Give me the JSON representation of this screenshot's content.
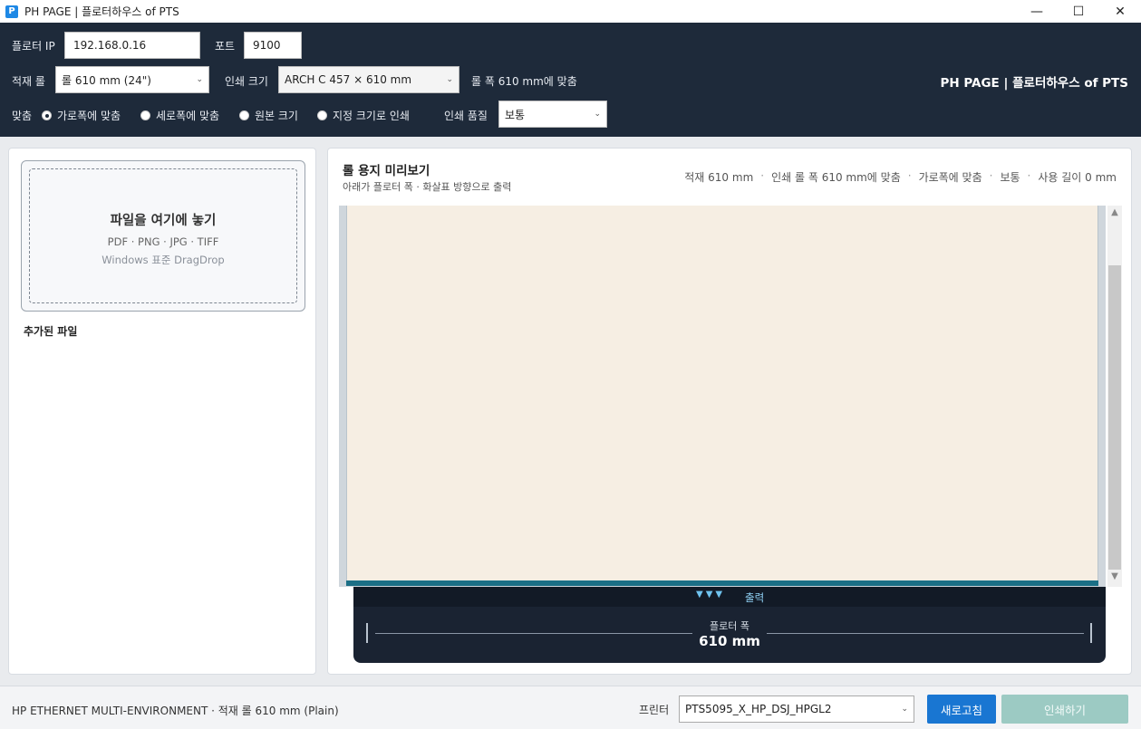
{
  "window": {
    "title": "PH PAGE | 플로터하우스 of PTS",
    "icon_label": "P",
    "min_icon": "—",
    "max_icon": "☐",
    "close_icon": "✕"
  },
  "header": {
    "plotter_ip_label": "플로터 IP",
    "plotter_ip_value": "192.168.0.16",
    "port_label": "포트",
    "port_value": "9100",
    "roll_label": "적재 롤",
    "roll_value": "롤 610 mm (24\")",
    "print_size_label": "인쇄 크기",
    "print_size_value": "ARCH C 457 × 610 mm",
    "fit_note": "롤 폭 610 mm에 맞춤",
    "brand": "PH PAGE | 플로터하우스 of PTS",
    "fit_label": "맞춤",
    "fit_options": [
      {
        "label": "가로폭에 맞춤",
        "selected": true
      },
      {
        "label": "세로폭에 맞춤",
        "selected": false
      },
      {
        "label": "원본 크기",
        "selected": false
      },
      {
        "label": "지정 크기로 인쇄",
        "selected": false
      }
    ],
    "quality_label": "인쇄 품질",
    "quality_value": "보통"
  },
  "left": {
    "drop_title": "파일을 여기에 놓기",
    "drop_formats": "PDF · PNG · JPG · TIFF",
    "drop_hint": "Windows 표준 DragDrop",
    "added_files_title": "추가된 파일"
  },
  "preview": {
    "title": "롤 용지 미리보기",
    "subtitle": "아래가 플로터 폭 · 화살표 방향으로 출력",
    "status": [
      "적재  610 mm",
      "인쇄  롤 폭 610 mm에 맞춤",
      "가로폭에 맞춤",
      "보통",
      "사용 길이  0 mm"
    ],
    "status_sep": "·",
    "output_arrows": "▼▼▼",
    "output_label": "출력",
    "plotter_width_label": "플로터 폭",
    "plotter_width_value": "610 mm",
    "scroll_up": "▲",
    "scroll_down": "▼"
  },
  "bottom": {
    "status": "HP ETHERNET MULTI-ENVIRONMENT · 적재 롤 610 mm (Plain)",
    "printer_label": "프린터",
    "printer_value": "PTS5095_X_HP_DSJ_HPGL2",
    "refresh_label": "새로고침",
    "print_label": "인쇄하기"
  },
  "colors": {
    "header_bg": "#1e2a3a",
    "paper": "#f6eee3",
    "primary_button": "#1976d2",
    "print_button_disabled": "#9ccac3"
  }
}
